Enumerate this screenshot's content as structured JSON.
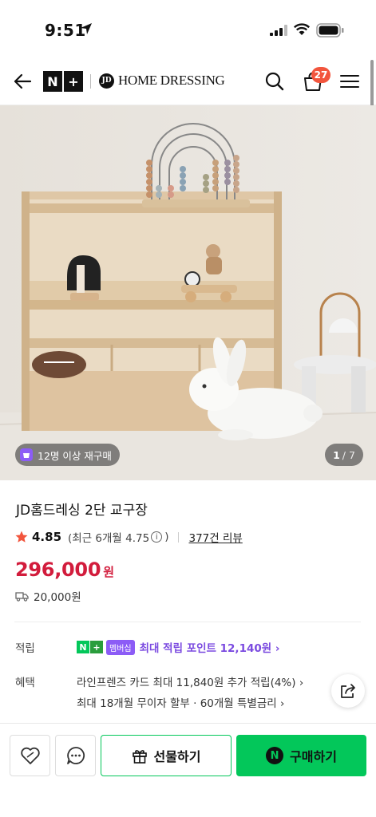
{
  "status": {
    "time": "9:51"
  },
  "header": {
    "logo_n": "N",
    "logo_plus": "+",
    "brand_initials": "JD",
    "brand_name": "HOME DRESSING",
    "cart_count": "27"
  },
  "gallery": {
    "repurchase_badge": "12명 이상 재구매",
    "current_page": "1",
    "total_pages": "/ 7"
  },
  "product": {
    "title": "JD홈드레싱 2단 교구장",
    "rating": "4.85",
    "recent_rating": "(최근 6개월 4.75",
    "recent_close": ")",
    "review_link": "377건 리뷰",
    "price": "296,000",
    "price_unit": "원",
    "shipping": "20,000원"
  },
  "points": {
    "label": "적립",
    "membership": "멤버십",
    "text": "최대 적립 포인트 12,140원 ›"
  },
  "benefits": {
    "label": "혜택",
    "line1": "라인프렌즈 카드 최대 11,840원 추가 적립(4%) ›",
    "line2": "최대 18개월 무이자 할부 · 60개월 특별금리 ›"
  },
  "actions": {
    "gift_label": "선물하기",
    "buy_label": "구매하기",
    "buy_icon": "N"
  },
  "colors": {
    "naver_green": "#03c75a",
    "price_red": "#d21c3c",
    "membership_purple": "#7b4be0",
    "cart_badge": "#f2553d"
  }
}
